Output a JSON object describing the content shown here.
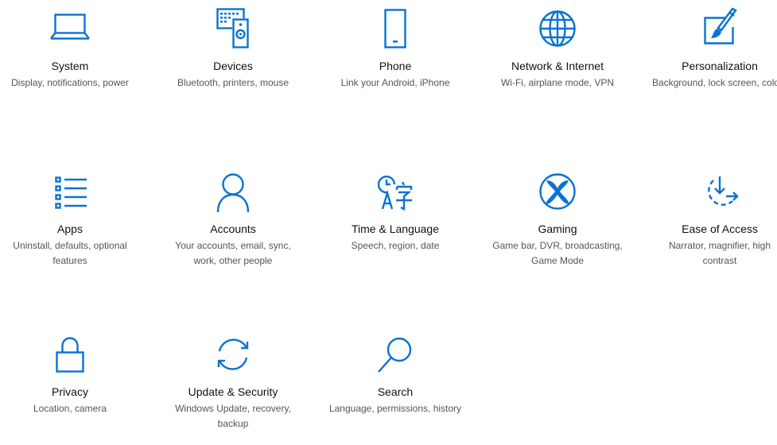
{
  "accent_color": "#0a73cf",
  "tiles": [
    {
      "icon": "laptop-icon",
      "title": "System",
      "desc": "Display, notifications, power"
    },
    {
      "icon": "keyboard-speaker-icon",
      "title": "Devices",
      "desc": "Bluetooth, printers, mouse"
    },
    {
      "icon": "phone-icon",
      "title": "Phone",
      "desc": "Link your Android, iPhone"
    },
    {
      "icon": "globe-icon",
      "title": "Network & Internet",
      "desc": "Wi-Fi, airplane mode, VPN"
    },
    {
      "icon": "paint-tablet-icon",
      "title": "Personalization",
      "desc": "Background, lock screen, colors"
    },
    {
      "icon": "app-list-icon",
      "title": "Apps",
      "desc": "Uninstall, defaults, optional features"
    },
    {
      "icon": "person-icon",
      "title": "Accounts",
      "desc": "Your accounts, email, sync, work, other people"
    },
    {
      "icon": "clock-language-icon",
      "title": "Time & Language",
      "desc": "Speech, region, date"
    },
    {
      "icon": "xbox-icon",
      "title": "Gaming",
      "desc": "Game bar, DVR, broadcasting, Game Mode"
    },
    {
      "icon": "ease-of-access-icon",
      "title": "Ease of Access",
      "desc": "Narrator, magnifier, high contrast"
    },
    {
      "icon": "lock-icon",
      "title": "Privacy",
      "desc": "Location, camera"
    },
    {
      "icon": "sync-arrows-icon",
      "title": "Update & Security",
      "desc": "Windows Update, recovery, backup"
    },
    {
      "icon": "magnifier-icon",
      "title": "Search",
      "desc": "Language, permissions, history"
    }
  ]
}
